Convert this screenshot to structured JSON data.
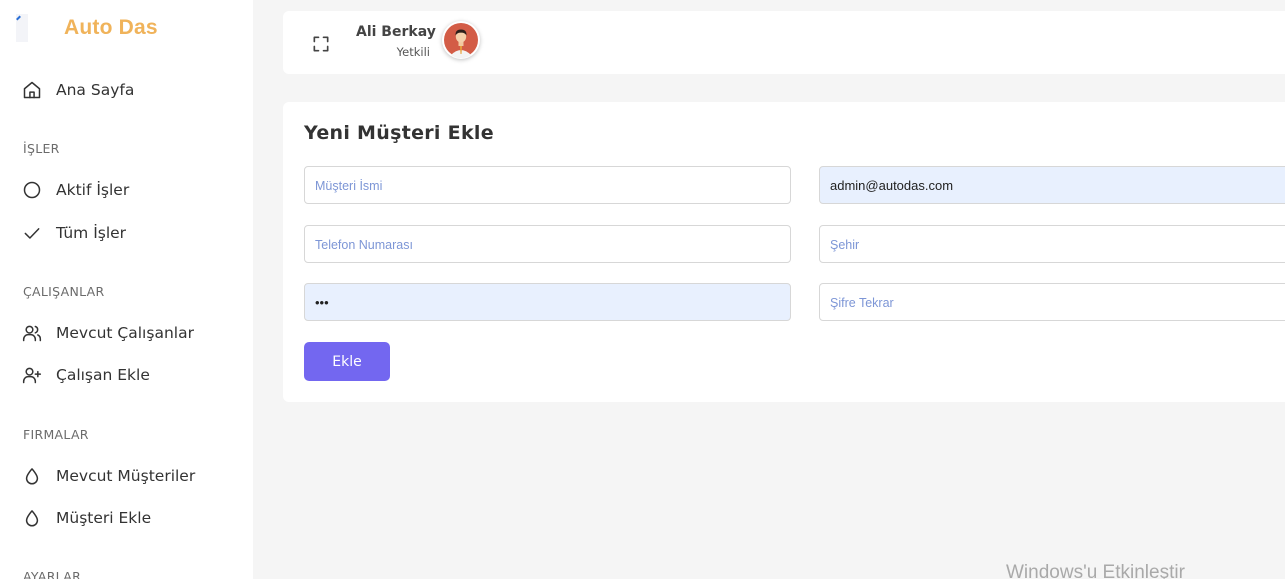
{
  "brand": {
    "name": "Auto Das"
  },
  "sidebar": {
    "home": {
      "label": "Ana Sayfa",
      "icon": "home-icon"
    },
    "sections": [
      {
        "title": "İŞLER",
        "items": [
          {
            "label": "Aktif İşler",
            "icon": "circle-icon"
          },
          {
            "label": "Tüm İşler",
            "icon": "check-icon"
          }
        ]
      },
      {
        "title": "ÇALIŞANLAR",
        "items": [
          {
            "label": "Mevcut Çalışanlar",
            "icon": "users-icon"
          },
          {
            "label": "Çalışan Ekle",
            "icon": "user-plus-icon"
          }
        ]
      },
      {
        "title": "FIRMALAR",
        "items": [
          {
            "label": "Mevcut Müşteriler",
            "icon": "droplet-icon"
          },
          {
            "label": "Müşteri Ekle",
            "icon": "droplet-icon"
          }
        ]
      },
      {
        "title": "AYARLAR",
        "items": []
      }
    ]
  },
  "header": {
    "user_name": "Ali Berkay",
    "user_role": "Yetkili"
  },
  "form": {
    "title": "Yeni Müşteri Ekle",
    "fields": {
      "name": {
        "placeholder": "Müşteri İsmi",
        "value": ""
      },
      "email": {
        "placeholder": "",
        "value": "admin@autodas.com"
      },
      "phone": {
        "placeholder": "Telefon Numarası",
        "value": ""
      },
      "city": {
        "placeholder": "Şehir",
        "value": ""
      },
      "password": {
        "placeholder": "",
        "value": "123"
      },
      "password_repeat": {
        "placeholder": "Şifre Tekrar",
        "value": ""
      }
    },
    "submit_label": "Ekle"
  },
  "watermark": {
    "text": "Windows'u Etkinleştir"
  },
  "colors": {
    "brand": "#f0b35a",
    "primary": "#7367f0",
    "autofill": "#e8f0fe"
  }
}
